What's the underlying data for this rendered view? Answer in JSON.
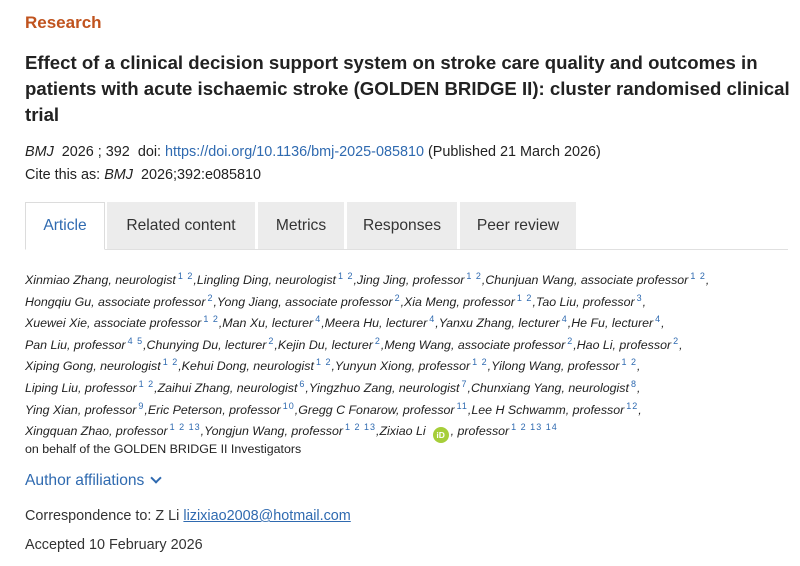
{
  "section_label": "Research",
  "title": "Effect of a clinical decision support system on stroke care quality and outcomes in patients with acute ischaemic stroke (GOLDEN BRIDGE II): cluster randomised clinical trial",
  "citation": {
    "journal": "BMJ",
    "year_volume": "2026 ; 392",
    "doi_label": "doi:",
    "doi_link": "https://doi.org/10.1136/bmj-2025-085810",
    "published": "(Published 21 March 2026)",
    "cite_as_label": "Cite this as:",
    "cite_journal": "BMJ",
    "cite_ref": "2026;392:e085810"
  },
  "tabs": [
    {
      "label": "Article",
      "active": true
    },
    {
      "label": "Related content",
      "active": false
    },
    {
      "label": "Metrics",
      "active": false
    },
    {
      "label": "Responses",
      "active": false
    },
    {
      "label": "Peer review",
      "active": false
    }
  ],
  "authors": [
    [
      {
        "name": "Xinmiao Zhang, neurologist",
        "sup": "1 2"
      },
      {
        "name": "Lingling Ding, neurologist",
        "sup": "1 2"
      },
      {
        "name": "Jing Jing, professor",
        "sup": "1 2"
      },
      {
        "name": "Chunjuan Wang, associate professor",
        "sup": "1 2"
      }
    ],
    [
      {
        "name": "Hongqiu Gu, associate professor",
        "sup": "2"
      },
      {
        "name": "Yong Jiang, associate professor",
        "sup": "2"
      },
      {
        "name": "Xia Meng, professor",
        "sup": "1 2"
      },
      {
        "name": "Tao Liu, professor",
        "sup": "3"
      }
    ],
    [
      {
        "name": "Xuewei Xie, associate professor",
        "sup": "1 2"
      },
      {
        "name": "Man Xu, lecturer",
        "sup": "4"
      },
      {
        "name": "Meera Hu, lecturer",
        "sup": "4"
      },
      {
        "name": "Yanxu Zhang, lecturer",
        "sup": "4"
      },
      {
        "name": "He Fu, lecturer",
        "sup": "4"
      }
    ],
    [
      {
        "name": "Pan Liu, professor",
        "sup": "4 5"
      },
      {
        "name": "Chunying Du, lecturer",
        "sup": "2"
      },
      {
        "name": "Kejin Du, lecturer",
        "sup": "2"
      },
      {
        "name": "Meng Wang, associate professor",
        "sup": "2"
      },
      {
        "name": "Hao Li, professor",
        "sup": "2"
      }
    ],
    [
      {
        "name": "Xiping Gong, neurologist",
        "sup": "1 2"
      },
      {
        "name": "Kehui Dong, neurologist",
        "sup": "1 2"
      },
      {
        "name": "Yunyun Xiong, professor",
        "sup": "1 2"
      },
      {
        "name": "Yilong Wang, professor",
        "sup": "1 2"
      }
    ],
    [
      {
        "name": "Liping Liu, professor",
        "sup": "1 2"
      },
      {
        "name": "Zaihui Zhang, neurologist",
        "sup": "6"
      },
      {
        "name": "Yingzhuo Zang, neurologist",
        "sup": "7"
      },
      {
        "name": "Chunxiang Yang, neurologist",
        "sup": "8"
      }
    ],
    [
      {
        "name": "Ying Xian, professor",
        "sup": "9"
      },
      {
        "name": "Eric Peterson, professor",
        "sup": "10"
      },
      {
        "name": "Gregg C Fonarow, professor",
        "sup": "11"
      },
      {
        "name": "Lee H Schwamm, professor",
        "sup": "12"
      }
    ],
    [
      {
        "name": "Xingquan Zhao, professor",
        "sup": "1 2 13"
      },
      {
        "name": "Yongjun Wang, professor",
        "sup": "1 2 13"
      },
      {
        "name": "Zixiao Li",
        "orcid": "iD",
        "suffix": ", professor",
        "sup": "1 2 13 14",
        "last": true
      }
    ]
  ],
  "behalf": "on behalf of the GOLDEN BRIDGE II Investigators",
  "affiliations_toggle": "Author affiliations",
  "correspondence": {
    "label": "Correspondence to: Z Li",
    "email": "lizixiao2008@hotmail.com"
  },
  "accepted": "Accepted 10 February 2026",
  "colors": {
    "accent": "#c0531e",
    "link": "#2f6ab0",
    "orcid": "#a6ce39",
    "tab_bg": "#ececec"
  }
}
